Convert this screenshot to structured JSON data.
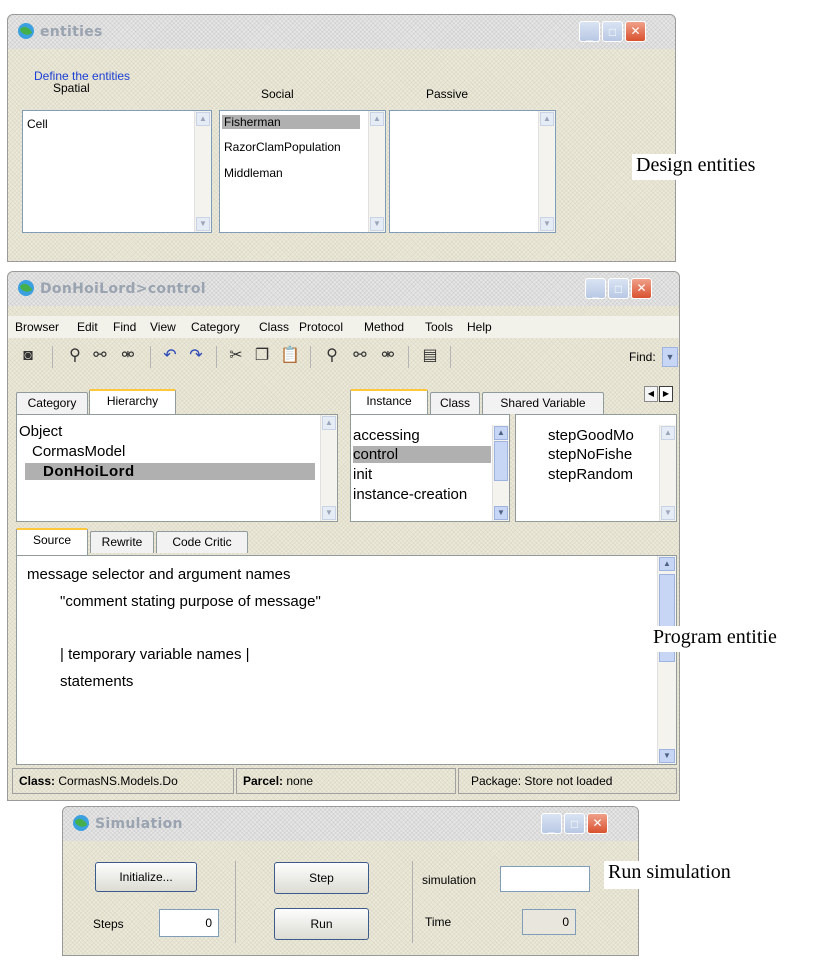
{
  "entities_window": {
    "title": "entities",
    "group_label": "Define the entities",
    "columns": [
      {
        "header": "Spatial",
        "items": [
          "Cell"
        ]
      },
      {
        "header": "Social",
        "items": [
          "Fisherman",
          "RazorClamPopulation",
          "Middleman"
        ],
        "selected": "Fisherman"
      },
      {
        "header": "Passive",
        "items": []
      }
    ]
  },
  "browser_window": {
    "title": "DonHoiLord>control",
    "menu": [
      "Browser",
      "Edit",
      "Find",
      "View",
      "Category",
      "Class",
      "Protocol",
      "Method",
      "Tools",
      "Help"
    ],
    "find_label": "Find:",
    "left_tabs": [
      "Category",
      "Hierarchy"
    ],
    "hierarchy": [
      "Object",
      "CormasModel",
      "DonHoiLord"
    ],
    "right_tabs": [
      "Instance",
      "Class",
      "Shared Variable"
    ],
    "protocols": [
      "accessing",
      "control",
      "init",
      "instance-creation"
    ],
    "selected_protocol": "control",
    "methods": [
      "stepGoodMo",
      "stepNoFishe",
      "stepRandom"
    ],
    "source_tabs": [
      "Source",
      "Rewrite",
      "Code Critic"
    ],
    "source_lines": [
      "message selector and argument names",
      "\"comment stating purpose of message\"",
      "",
      "| temporary variable names |",
      "statements"
    ],
    "status": {
      "class_label": "Class:",
      "class_value": "CormasNS.Models.Do",
      "parcel_label": "Parcel:",
      "parcel_value": "none",
      "package_text": "Package:  Store not loaded"
    }
  },
  "simulation_window": {
    "title": "Simulation",
    "initialize_label": "Initialize...",
    "steps_label": "Steps",
    "steps_value": "0",
    "step_label": "Step",
    "run_label": "Run",
    "simulation_label": "simulation",
    "simulation_value": "",
    "time_label": "Time",
    "time_value": "0"
  },
  "annotations": {
    "design": "Design entities",
    "program": "Program entitie",
    "run": "Run simulation"
  },
  "colors": {
    "selection": "#b0b0b0",
    "close_button": "#d9522f",
    "tab_highlight": "#ffc83c"
  }
}
